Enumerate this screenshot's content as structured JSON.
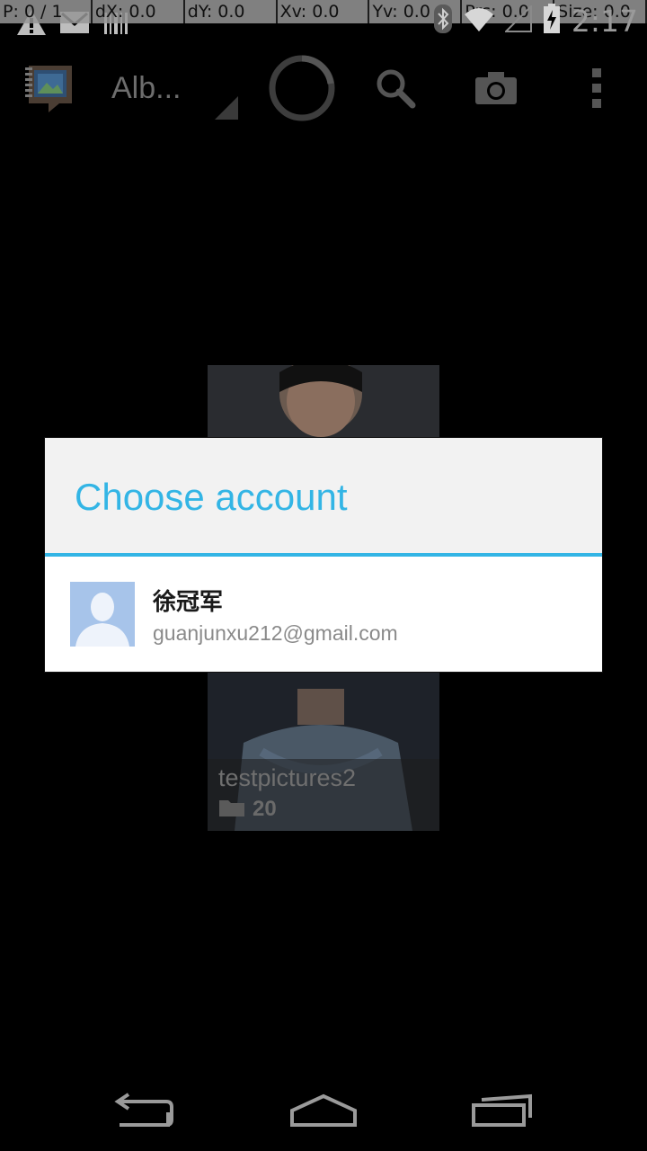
{
  "pointer_overlay": [
    {
      "label": "P: 0 / 1"
    },
    {
      "label": "dX: 0.0"
    },
    {
      "label": "dY: 0.0"
    },
    {
      "label": "Xv: 0.0"
    },
    {
      "label": "Yv: 0.0"
    },
    {
      "label": "Prs: 0.0"
    },
    {
      "label": "Size: 0.0"
    }
  ],
  "status_bar": {
    "time": "2:17",
    "left_icons": [
      "warning-icon",
      "gmail-icon",
      "barcode-icon"
    ],
    "right_icons": [
      "bluetooth-icon",
      "wifi-icon",
      "signal-icon",
      "battery-icon"
    ]
  },
  "action_bar": {
    "title": "Alb...",
    "icons": [
      "album-app-icon",
      "loading-spinner-icon",
      "search-icon",
      "camera-icon",
      "overflow-menu-icon"
    ]
  },
  "album": {
    "name": "testpictures2",
    "count": "20"
  },
  "dialog": {
    "title": "Choose account",
    "accounts": [
      {
        "name": "徐冠军",
        "email": "guanjunxu212@gmail.com"
      }
    ]
  },
  "nav_bar": {
    "buttons": [
      "back-icon",
      "home-icon",
      "recents-icon"
    ]
  },
  "colors": {
    "accent": "#33b5e5",
    "background": "#000000",
    "dialog_header": "#f2f2f2"
  }
}
